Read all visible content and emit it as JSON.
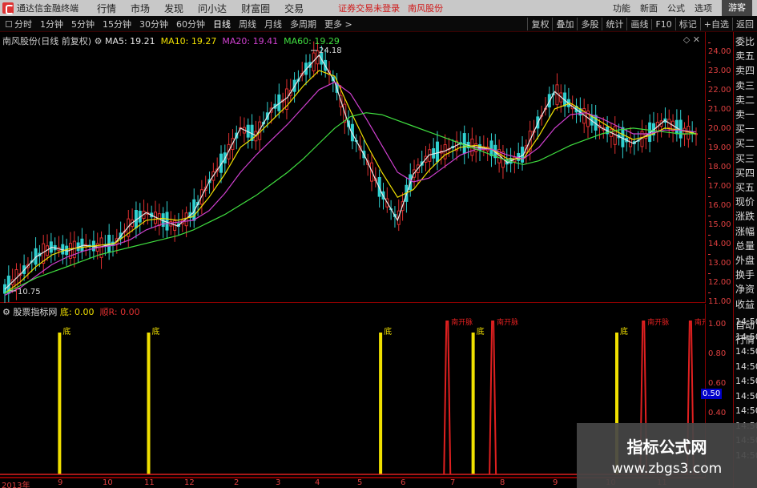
{
  "topbar": {
    "app_name": "通达信金融终端",
    "menu": [
      "行情",
      "市场",
      "发现",
      "问小达",
      "财富圈",
      "交易"
    ],
    "status": "证券交易未登录",
    "stock": "南风股份",
    "right_items": [
      "功能",
      "新面",
      "公式",
      "选项"
    ],
    "guest": "游客"
  },
  "toolbar": {
    "periods": [
      "分时",
      "1分钟",
      "5分钟",
      "15分钟",
      "30分钟",
      "60分钟",
      "日线",
      "周线",
      "月线",
      "多周期",
      "更多 >"
    ],
    "active": "日线",
    "right_items": [
      "复权",
      "叠加",
      "多股",
      "统计",
      "画线",
      "F10",
      "标记",
      "+自选",
      "返回"
    ]
  },
  "main_legend": {
    "title": "南风股份(日线 前复权)",
    "ma5": "MA5: 19.21",
    "ma10": "MA10: 19.27",
    "ma20": "MA20: 19.41",
    "ma60": "MA60: 19.29",
    "colors": {
      "ma5": "#e8e8e8",
      "ma10": "#f0e000",
      "ma20": "#d040d0",
      "ma60": "#40e040"
    }
  },
  "price_axis": [
    "24.00",
    "23.00",
    "22.00",
    "21.00",
    "20.00",
    "19.00",
    "18.00",
    "17.00",
    "16.00",
    "15.00",
    "14.00",
    "13.00",
    "12.00",
    "11.00"
  ],
  "annotations": {
    "high": "24.18",
    "low": "10.75"
  },
  "side_labels": [
    "委比",
    "卖五",
    "卖四",
    "卖三",
    "卖二",
    "卖一",
    "买一",
    "买二",
    "买三",
    "买四",
    "买五",
    "现价",
    "涨跌",
    "涨幅",
    "总量",
    "外盘",
    "换手",
    "净资",
    "收益",
    "自动",
    "行情"
  ],
  "indicator": {
    "name": "股票指标网",
    "v1": "底: 0.00",
    "v2": "顺R: 0.00",
    "axis": [
      "1.00",
      "0.80",
      "0.60",
      "0.40"
    ],
    "highlight": "0.50",
    "label_bottom": "底",
    "label_top": "南开脉",
    "signal_flag": "底"
  },
  "times": [
    "14:50",
    "14:50",
    "14:50",
    "14:50",
    "14:50",
    "14:50",
    "14:50",
    "14:50",
    "14:50",
    "14:50"
  ],
  "date_axis": [
    "2013年",
    "9",
    "10",
    "11",
    "12",
    "2",
    "3",
    "4",
    "5",
    "6",
    "7",
    "8",
    "9",
    "10",
    "11"
  ],
  "watermark": {
    "line1": "指标公式网",
    "line2": "www.zbgs3.com"
  },
  "chart_data": {
    "type": "line",
    "title": "南风股份(日线 前复权)",
    "ylim": [
      10.5,
      24.6
    ],
    "yticks": [
      24,
      23,
      22,
      21,
      20,
      19,
      18,
      17,
      16,
      15,
      14,
      13,
      12,
      11
    ],
    "series": [
      {
        "name": "MA5",
        "values": [
          11.2,
          12.0,
          12.9,
          13.4,
          13.2,
          13.5,
          13.4,
          13.6,
          14.6,
          15.2,
          14.8,
          14.5,
          15.2,
          16.8,
          18.0,
          19.6,
          19.2,
          20.6,
          21.2,
          22.5,
          23.4,
          22.0,
          19.5,
          18.0,
          16.2,
          14.8,
          17.2,
          18.2,
          18.4,
          18.8,
          18.6,
          18.5,
          17.8,
          18.2,
          20.0,
          21.5,
          20.8,
          20.2,
          19.6,
          19.2,
          18.8,
          19.3,
          20.0,
          19.5,
          19.3
        ]
      },
      {
        "name": "MA10",
        "values": [
          11.0,
          11.6,
          12.4,
          13.0,
          13.3,
          13.4,
          13.5,
          13.6,
          14.2,
          14.8,
          14.9,
          14.8,
          15.0,
          16.0,
          17.2,
          18.6,
          19.2,
          20.0,
          20.8,
          21.8,
          22.6,
          22.3,
          20.5,
          18.8,
          17.3,
          16.0,
          16.4,
          17.4,
          18.2,
          18.6,
          18.7,
          18.5,
          18.0,
          18.0,
          19.2,
          20.6,
          20.9,
          20.4,
          19.9,
          19.4,
          19.0,
          19.2,
          19.6,
          19.5,
          19.3
        ]
      },
      {
        "name": "MA20",
        "values": [
          10.9,
          11.3,
          11.9,
          12.5,
          12.9,
          13.2,
          13.4,
          13.5,
          13.8,
          14.3,
          14.6,
          14.7,
          14.8,
          15.3,
          16.2,
          17.3,
          18.2,
          19.0,
          19.8,
          20.7,
          21.6,
          22.0,
          21.4,
          20.1,
          18.7,
          17.3,
          16.8,
          17.0,
          17.6,
          18.2,
          18.5,
          18.5,
          18.2,
          18.0,
          18.6,
          19.6,
          20.3,
          20.4,
          20.1,
          19.7,
          19.3,
          19.3,
          19.5,
          19.5,
          19.4
        ]
      },
      {
        "name": "MA60",
        "values": [
          11.0,
          11.4,
          11.8,
          12.1,
          12.4,
          12.7,
          13.0,
          13.2,
          13.4,
          13.6,
          13.8,
          14.0,
          14.3,
          14.7,
          15.1,
          15.6,
          16.1,
          16.7,
          17.3,
          18.0,
          18.8,
          19.6,
          20.2,
          20.4,
          20.3,
          20.0,
          19.7,
          19.4,
          19.1,
          18.8,
          18.5,
          18.2,
          17.9,
          17.7,
          17.9,
          18.3,
          18.7,
          19.0,
          19.3,
          19.5,
          19.6,
          19.5,
          19.4,
          19.3,
          19.3
        ]
      }
    ],
    "indicator_bottom_signals_x": [
      0.085,
      0.212,
      0.543,
      0.675,
      0.88
    ],
    "indicator_top_signals_x": [
      0.638,
      0.703,
      0.918,
      0.985
    ]
  }
}
